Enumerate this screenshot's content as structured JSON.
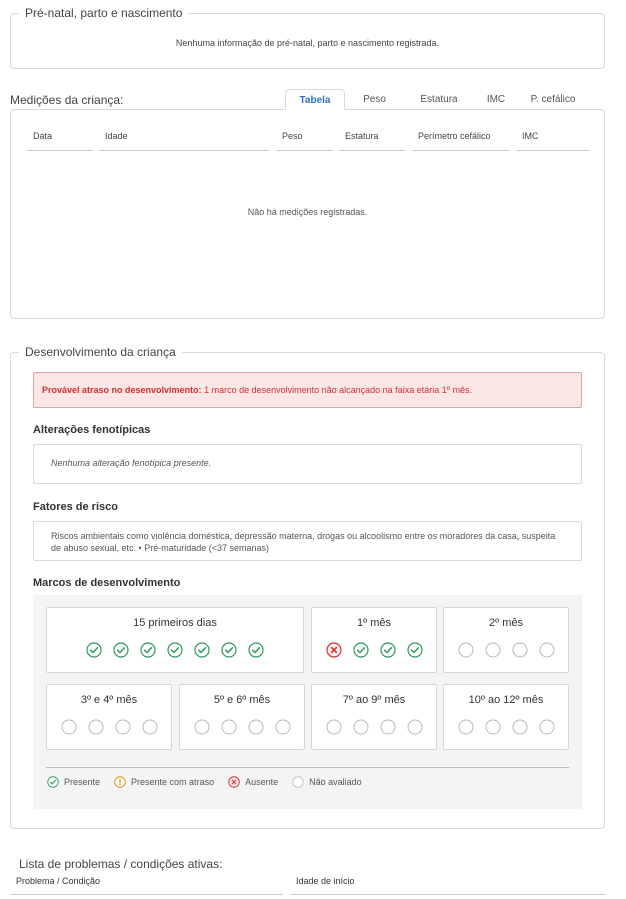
{
  "prenatal": {
    "legend": "Pré-natal, parto e nascimento",
    "message": "Nenhuma informação de pré-natal, parto e nascimento registrada."
  },
  "measurements": {
    "title": "Medições da criança:",
    "tabs": [
      {
        "label": "Tabela",
        "active": true
      },
      {
        "label": "Peso",
        "active": false
      },
      {
        "label": "Estatura",
        "active": false
      },
      {
        "label": "IMC",
        "active": false
      },
      {
        "label": "P. cefálico",
        "active": false
      }
    ],
    "columns": [
      "Data",
      "Idade",
      "Peso",
      "Estatura",
      "Perímetro cefálico",
      "IMC"
    ],
    "empty": "Não há medições registradas."
  },
  "development": {
    "legend": "Desenvolvimento da criança",
    "alert": {
      "bold": "Provável atraso no desenvolvimento:",
      "text": " 1 marco de desenvolvimento não alcançado na faixa etária 1º mês."
    },
    "phenotypic": {
      "title": "Alterações fenotípicas",
      "text": "Nenhuma alteração fenotípica presente."
    },
    "risk": {
      "title": "Fatores de risco",
      "text": "Riscos ambientais como violência doméstica, depressão materna, drogas ou alcoolismo entre os moradores da casa, suspeita de abuso sexual, etc. • Pré-maturidade (<37 semanas)"
    },
    "milestones": {
      "title": "Marcos de desenvolvimento",
      "groups": [
        {
          "label": "15 primeiros dias",
          "status": [
            "present",
            "present",
            "present",
            "present",
            "present",
            "present",
            "present"
          ]
        },
        {
          "label": "1º mês",
          "status": [
            "absent",
            "present",
            "present",
            "present"
          ]
        },
        {
          "label": "2º mês",
          "status": [
            "none",
            "none",
            "none",
            "none"
          ]
        },
        {
          "label": "3º e 4º mês",
          "status": [
            "none",
            "none",
            "none",
            "none"
          ]
        },
        {
          "label": "5º e 6º mês",
          "status": [
            "none",
            "none",
            "none",
            "none"
          ]
        },
        {
          "label": "7º ao 9º mês",
          "status": [
            "none",
            "none",
            "none",
            "none"
          ]
        },
        {
          "label": "10º ao 12º mês",
          "status": [
            "none",
            "none",
            "none",
            "none"
          ]
        }
      ],
      "legend": [
        {
          "status": "present",
          "label": "Presente"
        },
        {
          "status": "delayed",
          "label": "Presente com atraso"
        },
        {
          "status": "absent",
          "label": "Ausente"
        },
        {
          "status": "none",
          "label": "Não avaliado"
        }
      ]
    }
  },
  "problems": {
    "title": "Lista de problemas / condições ativas:",
    "columns": [
      "Problema / Condição",
      "Idade de início"
    ]
  },
  "colors": {
    "present": "#2e9a5a",
    "delayed": "#e08a00",
    "absent": "#d0302f",
    "none": "#b8b8b8",
    "accent": "#2a73c6"
  }
}
